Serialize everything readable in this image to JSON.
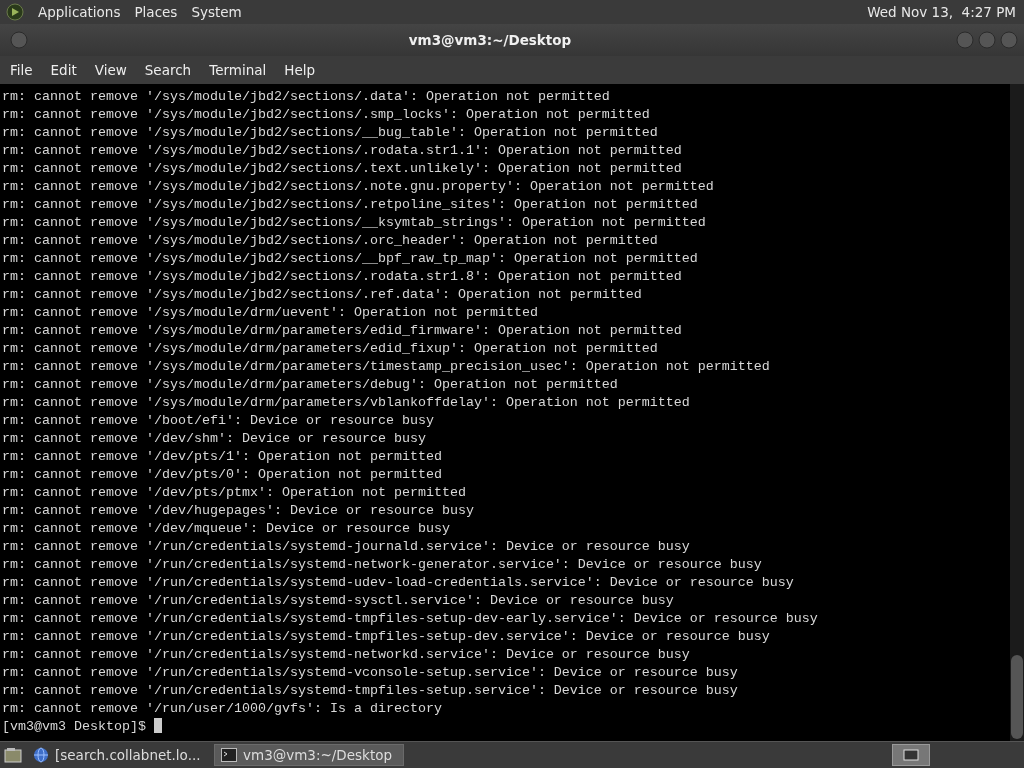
{
  "top_panel": {
    "menus": [
      "Applications",
      "Places",
      "System"
    ],
    "clock": "Wed Nov 13,  4:27 PM"
  },
  "window": {
    "title": "vm3@vm3:~/Desktop"
  },
  "menubar": [
    "File",
    "Edit",
    "View",
    "Search",
    "Terminal",
    "Help"
  ],
  "terminal": {
    "lines": [
      "rm: cannot remove '/sys/module/jbd2/sections/.data': Operation not permitted",
      "rm: cannot remove '/sys/module/jbd2/sections/.smp_locks': Operation not permitted",
      "rm: cannot remove '/sys/module/jbd2/sections/__bug_table': Operation not permitted",
      "rm: cannot remove '/sys/module/jbd2/sections/.rodata.str1.1': Operation not permitted",
      "rm: cannot remove '/sys/module/jbd2/sections/.text.unlikely': Operation not permitted",
      "rm: cannot remove '/sys/module/jbd2/sections/.note.gnu.property': Operation not permitted",
      "rm: cannot remove '/sys/module/jbd2/sections/.retpoline_sites': Operation not permitted",
      "rm: cannot remove '/sys/module/jbd2/sections/__ksymtab_strings': Operation not permitted",
      "rm: cannot remove '/sys/module/jbd2/sections/.orc_header': Operation not permitted",
      "rm: cannot remove '/sys/module/jbd2/sections/__bpf_raw_tp_map': Operation not permitted",
      "rm: cannot remove '/sys/module/jbd2/sections/.rodata.str1.8': Operation not permitted",
      "rm: cannot remove '/sys/module/jbd2/sections/.ref.data': Operation not permitted",
      "rm: cannot remove '/sys/module/drm/uevent': Operation not permitted",
      "rm: cannot remove '/sys/module/drm/parameters/edid_firmware': Operation not permitted",
      "rm: cannot remove '/sys/module/drm/parameters/edid_fixup': Operation not permitted",
      "rm: cannot remove '/sys/module/drm/parameters/timestamp_precision_usec': Operation not permitted",
      "rm: cannot remove '/sys/module/drm/parameters/debug': Operation not permitted",
      "rm: cannot remove '/sys/module/drm/parameters/vblankoffdelay': Operation not permitted",
      "rm: cannot remove '/boot/efi': Device or resource busy",
      "rm: cannot remove '/dev/shm': Device or resource busy",
      "rm: cannot remove '/dev/pts/1': Operation not permitted",
      "rm: cannot remove '/dev/pts/0': Operation not permitted",
      "rm: cannot remove '/dev/pts/ptmx': Operation not permitted",
      "rm: cannot remove '/dev/hugepages': Device or resource busy",
      "rm: cannot remove '/dev/mqueue': Device or resource busy",
      "rm: cannot remove '/run/credentials/systemd-journald.service': Device or resource busy",
      "rm: cannot remove '/run/credentials/systemd-network-generator.service': Device or resource busy",
      "rm: cannot remove '/run/credentials/systemd-udev-load-credentials.service': Device or resource busy",
      "rm: cannot remove '/run/credentials/systemd-sysctl.service': Device or resource busy",
      "rm: cannot remove '/run/credentials/systemd-tmpfiles-setup-dev-early.service': Device or resource busy",
      "rm: cannot remove '/run/credentials/systemd-tmpfiles-setup-dev.service': Device or resource busy",
      "rm: cannot remove '/run/credentials/systemd-networkd.service': Device or resource busy",
      "rm: cannot remove '/run/credentials/systemd-vconsole-setup.service': Device or resource busy",
      "rm: cannot remove '/run/credentials/systemd-tmpfiles-setup.service': Device or resource busy",
      "rm: cannot remove '/run/user/1000/gvfs': Is a directory"
    ],
    "prompt": "[vm3@vm3 Desktop]$ "
  },
  "taskbar": {
    "tasks": [
      {
        "kind": "browser",
        "label": "[search.collabnet.lo...",
        "selected": false
      },
      {
        "kind": "terminal",
        "label": "vm3@vm3:~/Desktop",
        "selected": true
      }
    ]
  }
}
